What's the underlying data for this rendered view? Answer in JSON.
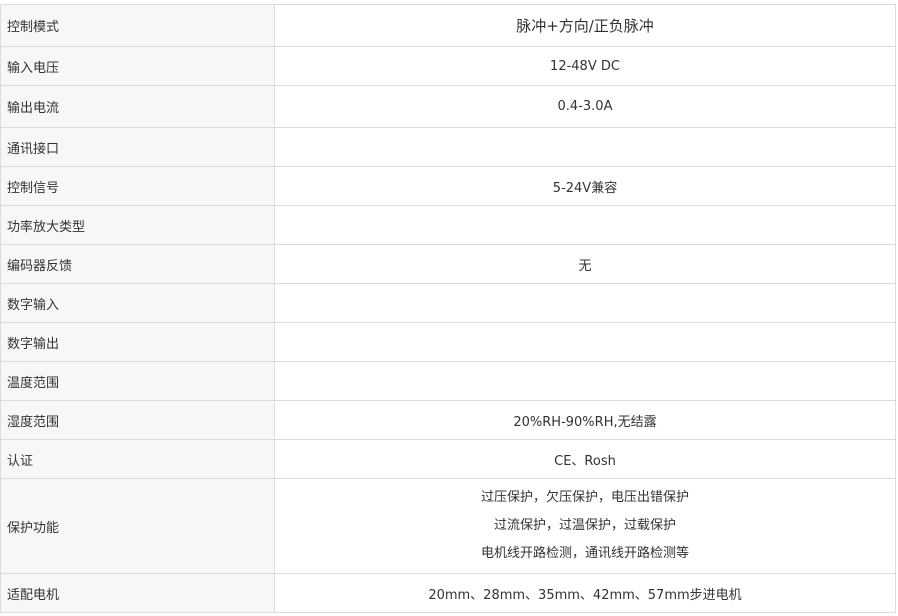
{
  "rows": [
    {
      "label": "控制模式",
      "value": "脉冲+方向/正负脉冲"
    },
    {
      "label": "输入电压",
      "value": "12-48V DC"
    },
    {
      "label": "输出电流",
      "value": "0.4-3.0A"
    },
    {
      "label": "通讯接口",
      "value": ""
    },
    {
      "label": "控制信号",
      "value": "5-24V兼容"
    },
    {
      "label": "功率放大类型",
      "value": ""
    },
    {
      "label": "编码器反馈",
      "value": "无"
    },
    {
      "label": "数字输入",
      "value": ""
    },
    {
      "label": "数字输出",
      "value": ""
    },
    {
      "label": "温度范围",
      "value": ""
    },
    {
      "label": "湿度范围",
      "value": "20%RH-90%RH,无结露"
    },
    {
      "label": "认证",
      "value": "CE、Rosh"
    },
    {
      "label": "保护功能",
      "lines": [
        "过压保护，欠压保护，电压出错保护",
        "过流保护，过温保护，过载保护",
        "电机线开路检测，通讯线开路检测等"
      ]
    },
    {
      "label": "适配电机",
      "value": "20mm、28mm、35mm、42mm、57mm步进电机"
    }
  ]
}
